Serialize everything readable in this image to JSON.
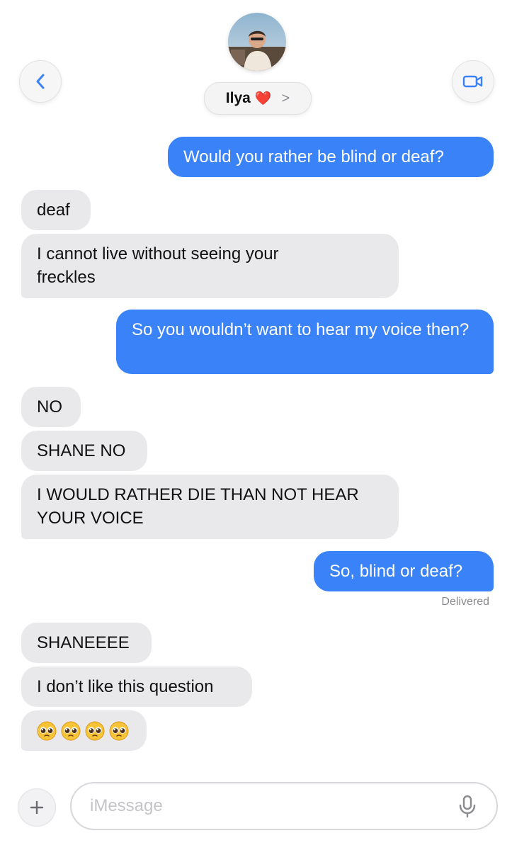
{
  "header": {
    "contact_name": "Ilya",
    "name_emoji": "❤️",
    "chevron": ">",
    "icons": [
      "chevron-left-icon",
      "video-camera-icon"
    ],
    "accent": "#3a82f7"
  },
  "messages": [
    {
      "from": "me",
      "text": "Would you rather be blind or deaf?"
    },
    {
      "from": "them",
      "text": "deaf"
    },
    {
      "from": "them",
      "text": "I cannot live without seeing your freckles"
    },
    {
      "from": "me",
      "text": "So you wouldn’t want to hear my voice then?"
    },
    {
      "from": "them",
      "text": "NO"
    },
    {
      "from": "them",
      "text": "SHANE NO"
    },
    {
      "from": "them",
      "text": "I WOULD RATHER DIE THAN NOT HEAR YOUR VOICE"
    },
    {
      "from": "me",
      "text": "So, blind or deaf?"
    },
    {
      "from": "them",
      "text": "SHANEEEE"
    },
    {
      "from": "them",
      "text": "I don’t like this question"
    },
    {
      "from": "them",
      "text": "🥺🥺🥺🥺"
    }
  ],
  "status": {
    "delivered": "Delivered"
  },
  "composer": {
    "placeholder": "iMessage",
    "plus_label": "+"
  },
  "colors": {
    "outgoing": "#3a82f7",
    "incoming": "#e9e9eb",
    "background": "#ffffff"
  }
}
